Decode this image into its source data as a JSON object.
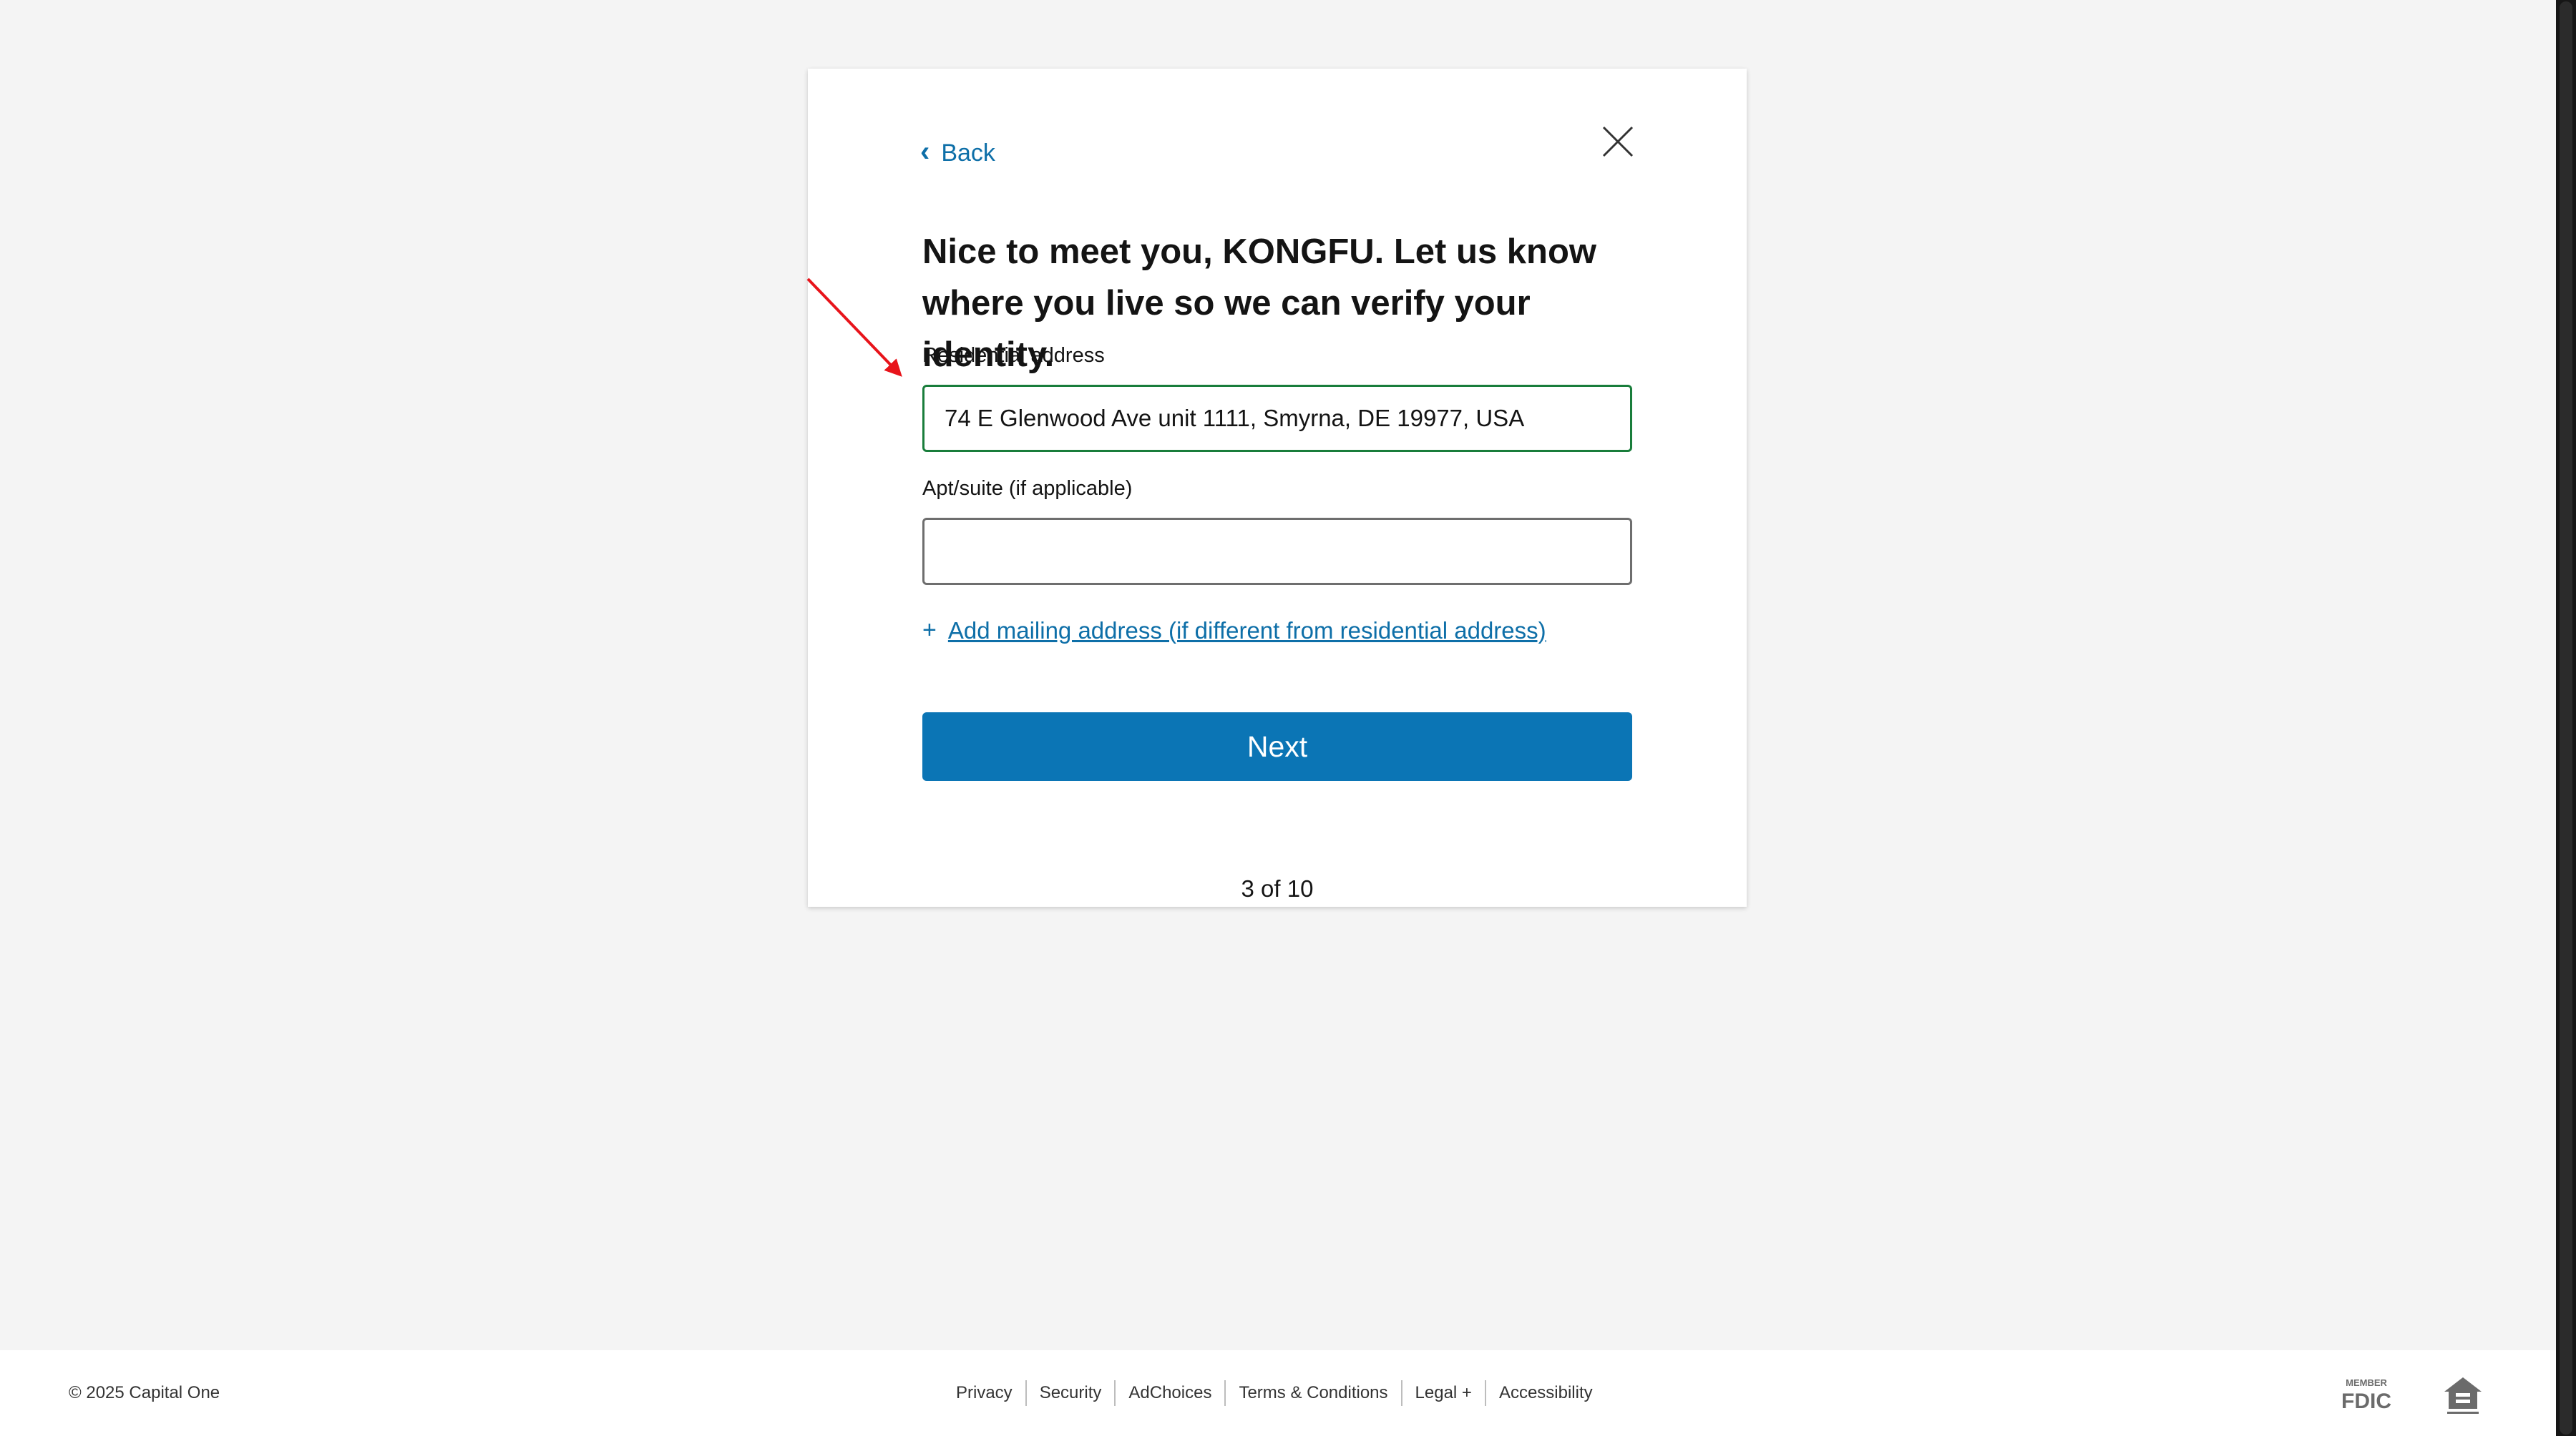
{
  "card": {
    "back_label": "Back",
    "heading": "Nice to meet you, KONGFU. Let us know where you live so we can verify your identity.",
    "residential_label": "Residential address",
    "residential_value": "74 E Glenwood Ave unit 1111, Smyrna, DE 19977, USA",
    "apt_label": "Apt/suite (if applicable)",
    "apt_value": "",
    "add_mailing_label": "Add mailing address (if different from residential address)",
    "next_label": "Next",
    "step_text": "3 of 10"
  },
  "footer": {
    "copyright": "© 2025 Capital One",
    "links": [
      "Privacy",
      "Security",
      "AdChoices",
      "Terms & Conditions",
      "Legal +",
      "Accessibility"
    ],
    "fdic_top": "MEMBER",
    "fdic_main": "FDIC"
  },
  "colors": {
    "accent": "#0b75b5",
    "link": "#0e6fa8",
    "focus_border": "#197d3b",
    "annotation": "#e8141b"
  }
}
